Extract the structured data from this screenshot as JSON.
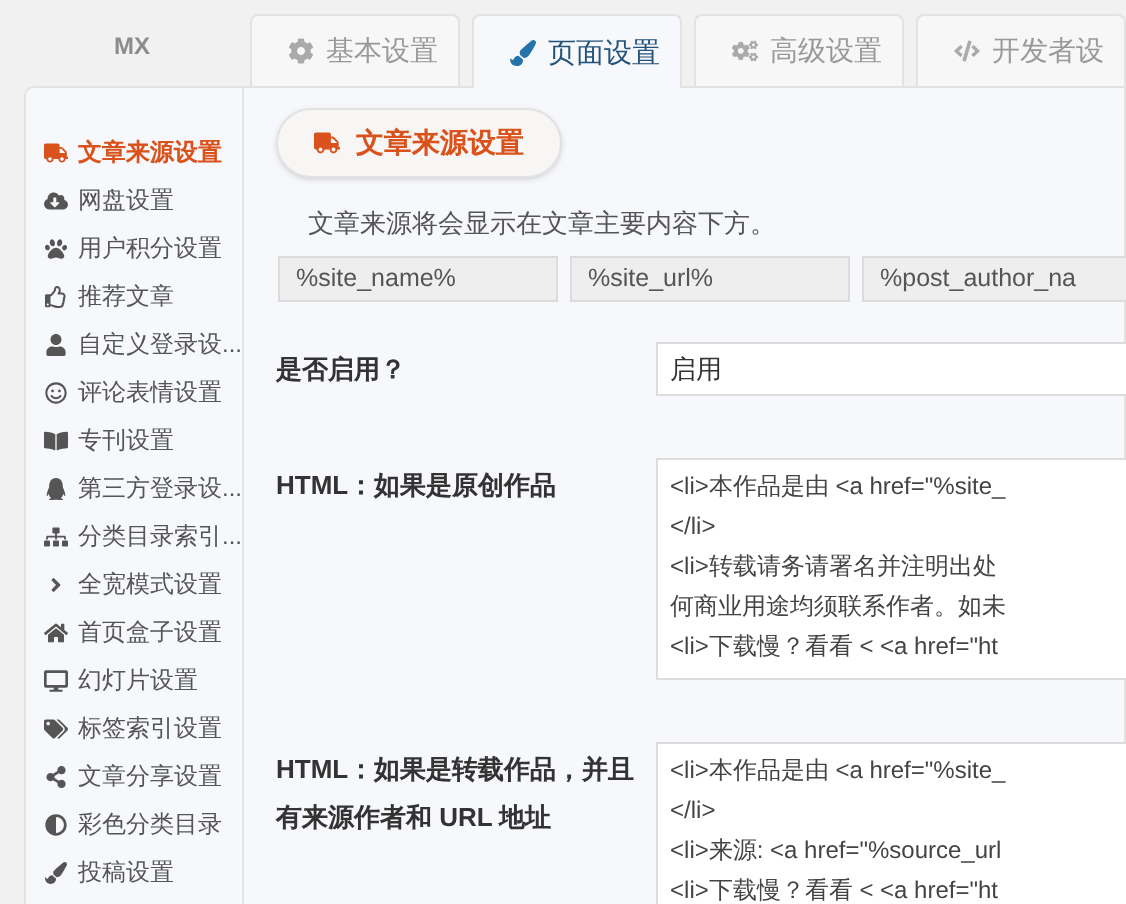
{
  "brand": "MX",
  "tabs": [
    {
      "label": "基本设置",
      "selected": false
    },
    {
      "label": "页面设置",
      "selected": true
    },
    {
      "label": "高级设置",
      "selected": false
    },
    {
      "label": "开发者设",
      "selected": false
    }
  ],
  "sidebar": {
    "items": [
      {
        "label": "文章来源设置",
        "selected": true
      },
      {
        "label": "网盘设置",
        "selected": false
      },
      {
        "label": "用户积分设置",
        "selected": false
      },
      {
        "label": "推荐文章",
        "selected": false
      },
      {
        "label": "自定义登录设...",
        "selected": false
      },
      {
        "label": "评论表情设置",
        "selected": false
      },
      {
        "label": "专刊设置",
        "selected": false
      },
      {
        "label": "第三方登录设...",
        "selected": false
      },
      {
        "label": "分类目录索引...",
        "selected": false
      },
      {
        "label": "全宽模式设置",
        "selected": false
      },
      {
        "label": "首页盒子设置",
        "selected": false
      },
      {
        "label": "幻灯片设置",
        "selected": false
      },
      {
        "label": "标签索引设置",
        "selected": false
      },
      {
        "label": "文章分享设置",
        "selected": false
      },
      {
        "label": "彩色分类目录",
        "selected": false
      },
      {
        "label": "投稿设置",
        "selected": false
      }
    ]
  },
  "section": {
    "title": "文章来源设置",
    "description": "文章来源将会显示在文章主要内容下方。",
    "variables": [
      "%site_name%",
      "%site_url%",
      "%post_author_na"
    ],
    "fields": [
      {
        "kind": "input",
        "label": "是否启用？",
        "value": "启用"
      },
      {
        "kind": "textarea",
        "label": "HTML：如果是原创作品",
        "lines": [
          "<li>本作品是由 <a href=\"%site_",
          "</li>",
          "<li>转载请务请署名并注明出处",
          "何商业用途均须联系作者。如未",
          "<li>下载慢？看看 < <a href=\"ht"
        ]
      },
      {
        "kind": "textarea",
        "label": "HTML：如果是转载作品，并且有来源作者和 URL 地址",
        "lines": [
          "<li>本作品是由 <a href=\"%site_",
          "</li>",
          "<li>来源: <a href=\"%source_url",
          "<li>下载慢？看看 < <a href=\"ht"
        ]
      }
    ]
  }
}
